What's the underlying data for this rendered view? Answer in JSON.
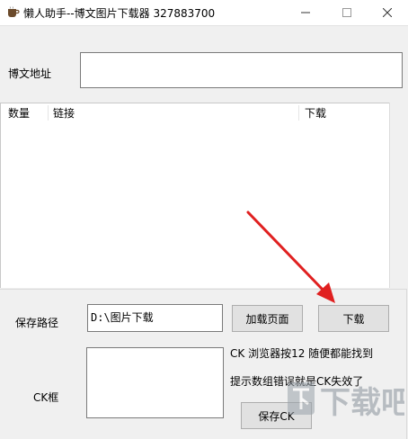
{
  "window": {
    "title": "懒人助手--博文图片下载器  327883700",
    "minimize_icon": "minimize-icon",
    "maximize_icon": "maximize-icon",
    "close_icon": "close-icon"
  },
  "url_field": {
    "label": "博文地址",
    "value": ""
  },
  "table": {
    "columns": [
      "数量",
      "链接",
      "下载"
    ],
    "rows": []
  },
  "save_path": {
    "label": "保存路径",
    "value": "D:\\图片下载"
  },
  "buttons": {
    "load_page": "加载页面",
    "download": "下载",
    "save_ck": "保存CK"
  },
  "ck": {
    "label": "CK框",
    "value": "",
    "hint_1": "CK 浏览器按12 随便都能找到",
    "hint_2": "提示数组错误就是CK失效了"
  },
  "annotation_arrow_color": "#e02020",
  "watermark": {
    "text": "下载吧"
  }
}
